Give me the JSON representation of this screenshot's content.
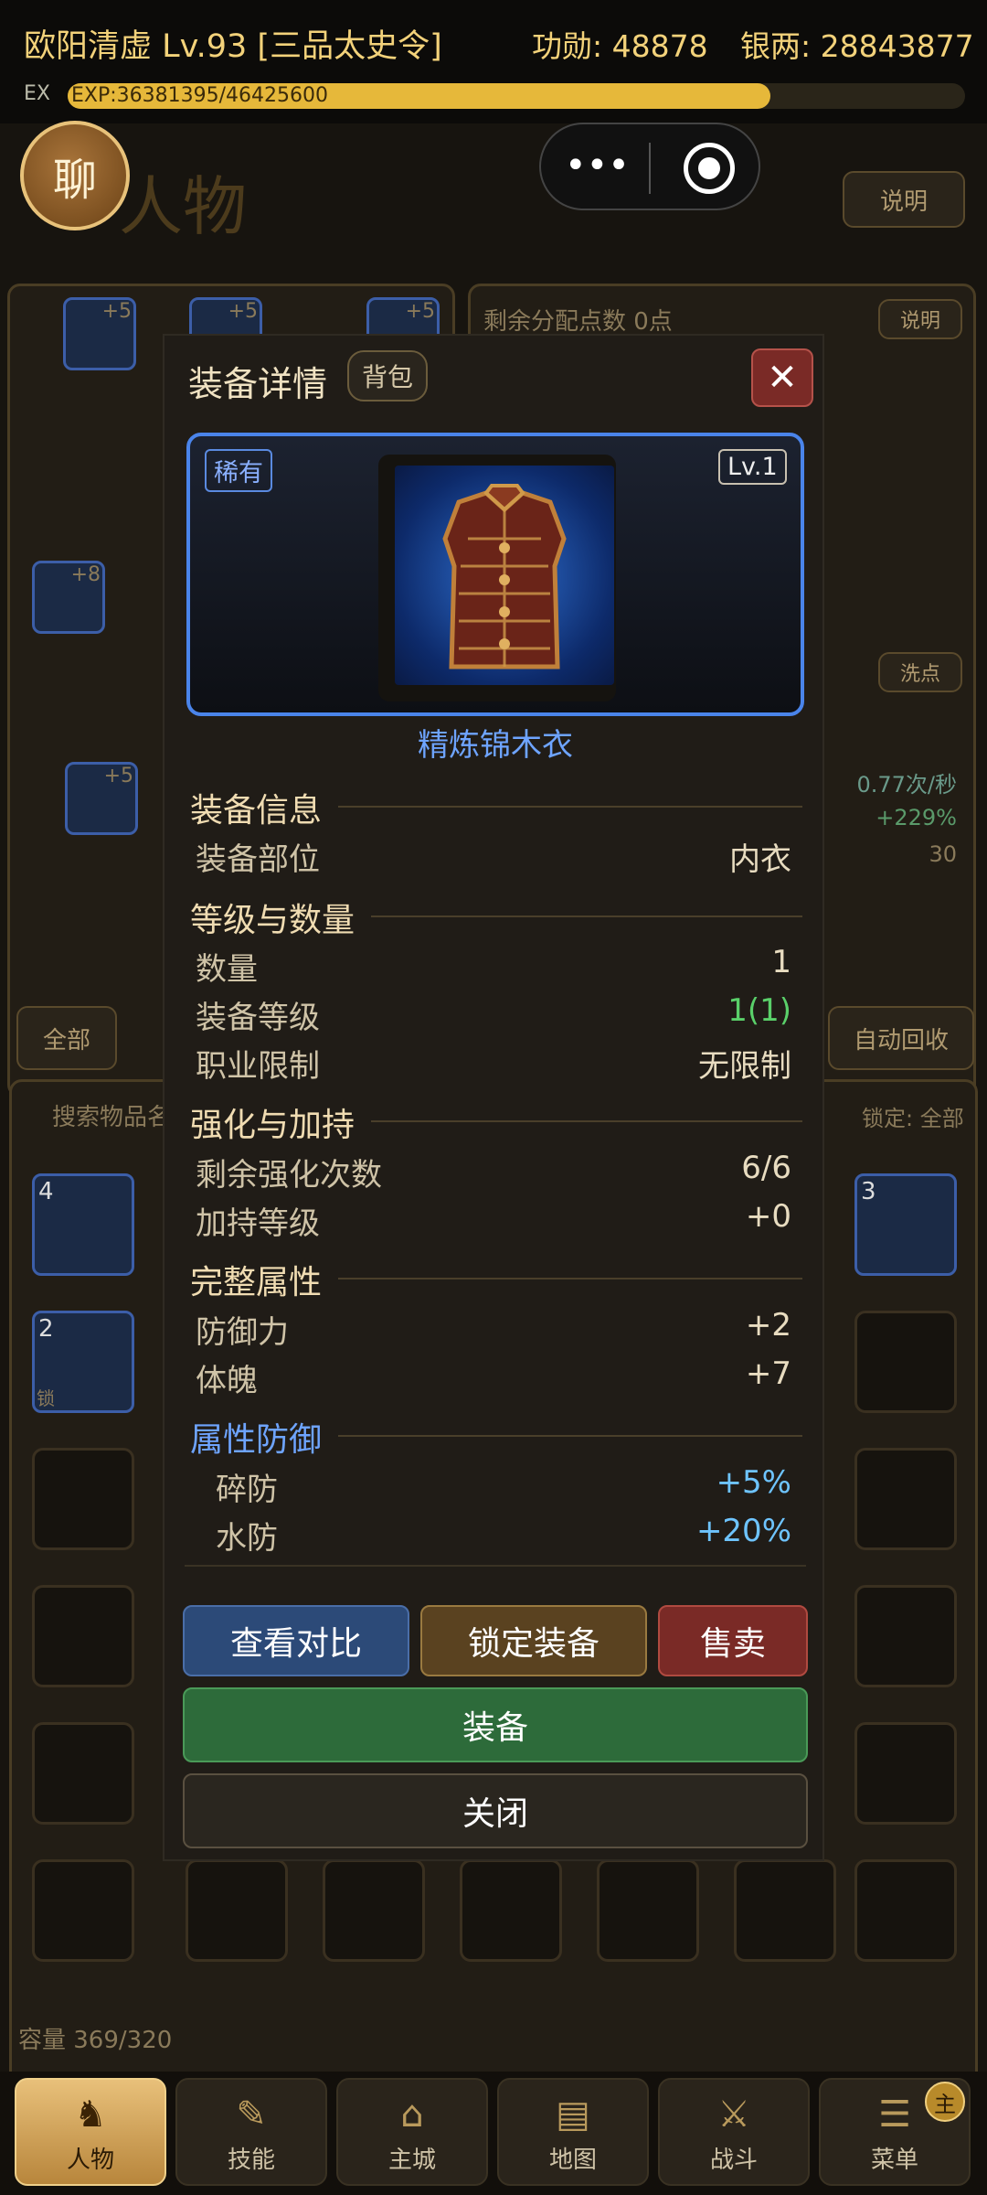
{
  "top": {
    "name": "欧阳清虚 Lv.93 [三品太史令]",
    "merit": "功勋: 48878",
    "silver": "银两: 28843877",
    "ex_label": "EX",
    "exp_text": "EXP:36381395/46425600",
    "exp_progress": 0.7836
  },
  "background": {
    "chat_label": "聊",
    "title_text": "人物",
    "explain_label": "说明",
    "points_label": "剩余分配点数 0点",
    "points_explain": "说明",
    "wash_label": "洗点",
    "rate": "0.77次/秒",
    "pct": "+229%",
    "thirty": "30",
    "all_tab": "全部",
    "auto_recycle": "自动回收",
    "search_placeholder": "搜索物品名",
    "lock_filter": "锁定: 全部",
    "capacity": "容量 369/320",
    "slot_badges": [
      "+5",
      "+5",
      "+5",
      "+8",
      "+5"
    ],
    "inv_counts": [
      "4",
      "3",
      "2"
    ],
    "lock_tag": "锁"
  },
  "modal": {
    "title": "装备详情",
    "bag_tag": "背包",
    "close_label": "✕",
    "rarity": "稀有",
    "level": "Lv.1",
    "item_name": "精炼锦木衣",
    "sections": {
      "info": "装备信息",
      "level_qty": "等级与数量",
      "enhance": "强化与加持",
      "attrs": "完整属性",
      "elem_def": "属性防御"
    },
    "rows": {
      "slot_label": "装备部位",
      "slot_value": "内衣",
      "qty_label": "数量",
      "qty_value": "1",
      "eqlvl_label": "装备等级",
      "eqlvl_value": "1(1)",
      "class_label": "职业限制",
      "class_value": "无限制",
      "enh_label": "剩余强化次数",
      "enh_value": "6/6",
      "bless_label": "加持等级",
      "bless_value": "+0",
      "def_label": "防御力",
      "def_value": "+2",
      "phy_label": "体魄",
      "phy_value": "+7",
      "crush_label": "碎防",
      "crush_value": "+5%",
      "water_label": "水防",
      "water_value": "+20%"
    },
    "buttons": {
      "compare": "查看对比",
      "lock": "锁定装备",
      "sell": "售卖",
      "equip": "装备",
      "close": "关闭"
    }
  },
  "nav": [
    {
      "label": "人物",
      "icon": "character-icon"
    },
    {
      "label": "技能",
      "icon": "skill-scroll-icon"
    },
    {
      "label": "主城",
      "icon": "city-pagoda-icon"
    },
    {
      "label": "地图",
      "icon": "map-scroll-icon"
    },
    {
      "label": "战斗",
      "icon": "crossed-swords-icon"
    },
    {
      "label": "菜单",
      "icon": "menu-scroll-icon"
    }
  ],
  "nav_badge": "主",
  "colors": {
    "accent": "#f3d27a",
    "rare_blue": "#4a84ea",
    "green": "#2d6b3a",
    "red": "#7a2a26"
  }
}
